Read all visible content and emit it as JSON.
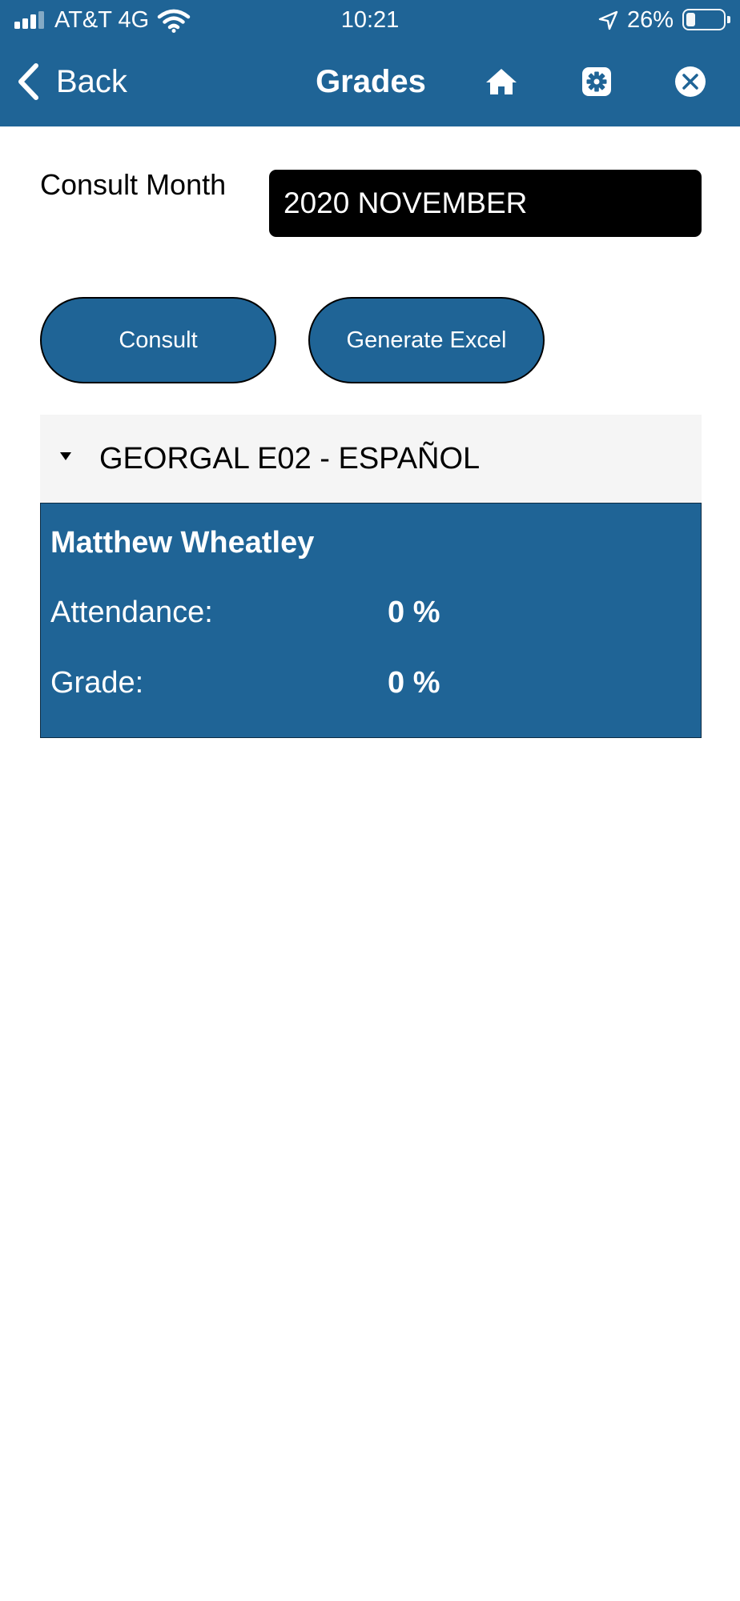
{
  "status_bar": {
    "carrier": "AT&T 4G",
    "time": "10:21",
    "battery_percent": "26%",
    "battery_level": 0.26,
    "icons": [
      "signal-icon",
      "wifi-icon",
      "location-arrow-icon",
      "battery-icon"
    ]
  },
  "nav": {
    "back_label": "Back",
    "title": "Grades",
    "icons": [
      "chevron-left-icon",
      "home-icon",
      "gear-icon",
      "close-icon"
    ]
  },
  "form": {
    "month_label": "Consult Month",
    "month_value": "2020 NOVEMBER"
  },
  "buttons": {
    "consult": "Consult",
    "generate_excel": "Generate Excel"
  },
  "group": {
    "title": "GEORGAL E02 - ESPAÑOL",
    "expanded": true,
    "students": [
      {
        "name": "Matthew Wheatley",
        "attendance_label": "Attendance:",
        "attendance_value": "0 %",
        "grade_label": "Grade:",
        "grade_value": "0 %"
      }
    ]
  },
  "colors": {
    "primary": "#1f6496",
    "select_bg": "#000000",
    "group_header_bg": "#f5f5f5",
    "text_on_primary": "#ffffff"
  }
}
